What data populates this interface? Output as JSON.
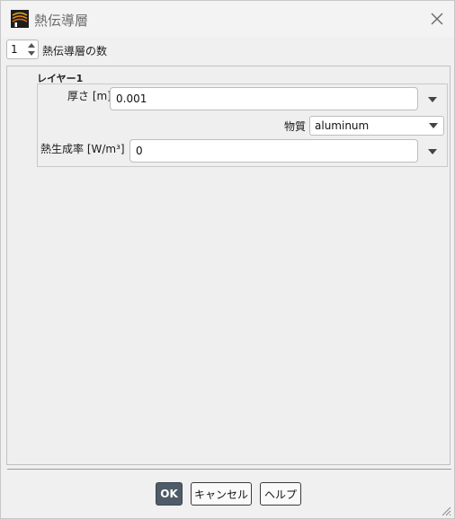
{
  "window": {
    "title": "熱伝導層",
    "app_icon": "ansys-fluent-icon",
    "close_icon": "close-icon"
  },
  "layers_count": {
    "value": "1",
    "label": "熱伝導層の数"
  },
  "layer": {
    "title": "レイヤー1",
    "thickness_label": "厚さ [m]",
    "thickness_value": "0.001",
    "material_label": "物質",
    "material_value": "aluminum",
    "heat_gen_label": "熱生成率 [W/m³]",
    "heat_gen_value": "0"
  },
  "buttons": {
    "ok": "OK",
    "cancel": "キャンセル",
    "help": "ヘルプ"
  },
  "colors": {
    "primary_button": "#4f5b67",
    "background": "#f0f0f0"
  }
}
